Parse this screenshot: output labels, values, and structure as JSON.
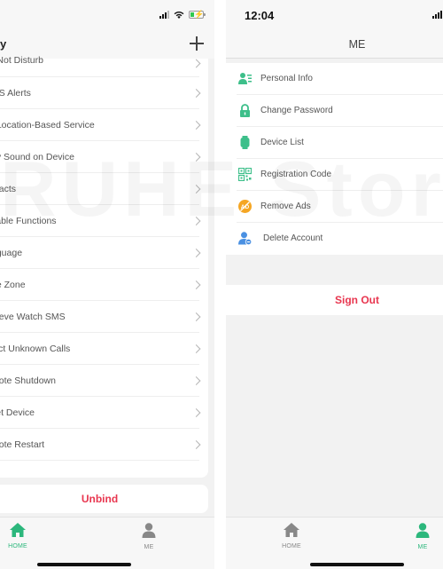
{
  "left_screen": {
    "status_bar": {
      "signal_icon": "signal-icon",
      "wifi_icon": "wifi-icon",
      "battery_icon": "battery-charging-icon"
    },
    "nav": {
      "title": "y",
      "add_icon": "plus-icon"
    },
    "settings_items": [
      {
        "label": "- Not Disturb"
      },
      {
        "label": "MS Alerts"
      },
      {
        "label": "t Location-Based Service"
      },
      {
        "label": "ay Sound on Device"
      },
      {
        "label": "ntacts"
      },
      {
        "label": "sable Functions"
      },
      {
        "label": "nguage"
      },
      {
        "label": "ne Zone"
      },
      {
        "label": "trieve Watch SMS"
      },
      {
        "label": "ject Unknown Calls"
      },
      {
        "label": "mote Shutdown"
      },
      {
        "label": "set Device"
      },
      {
        "label": "mote Restart"
      }
    ],
    "unbind_label": "Unbind",
    "tabs": [
      {
        "label": "HOME",
        "icon": "home-icon",
        "active": true
      },
      {
        "label": "ME",
        "icon": "person-icon",
        "active": false
      }
    ]
  },
  "right_screen": {
    "status_bar": {
      "time": "12:04",
      "signal_icon": "signal-icon"
    },
    "nav": {
      "title": "ME"
    },
    "menu_items": [
      {
        "label": "Personal Info",
        "icon": "personal-info-icon",
        "color": "#3dbf8a"
      },
      {
        "label": "Change Password",
        "icon": "lock-icon",
        "color": "#3dbf8a"
      },
      {
        "label": "Device List",
        "icon": "watch-icon",
        "color": "#3dbf8a"
      },
      {
        "label": "Registration Code",
        "icon": "qr-code-icon",
        "color": "#3dbf8a"
      },
      {
        "label": "Remove Ads",
        "icon": "no-ads-icon",
        "color": "#f5a623"
      },
      {
        "label": "Delete Account",
        "icon": "delete-account-icon",
        "color": "#4a90e2"
      }
    ],
    "sign_out_label": "Sign Out",
    "tabs": [
      {
        "label": "HOME",
        "icon": "home-icon",
        "active": false
      },
      {
        "label": "ME",
        "icon": "person-icon",
        "active": true
      }
    ]
  },
  "watermark": "RUHE Store",
  "colors": {
    "accent_green": "#2cb77c",
    "danger_red": "#e8364f",
    "inactive_gray": "#888888"
  }
}
